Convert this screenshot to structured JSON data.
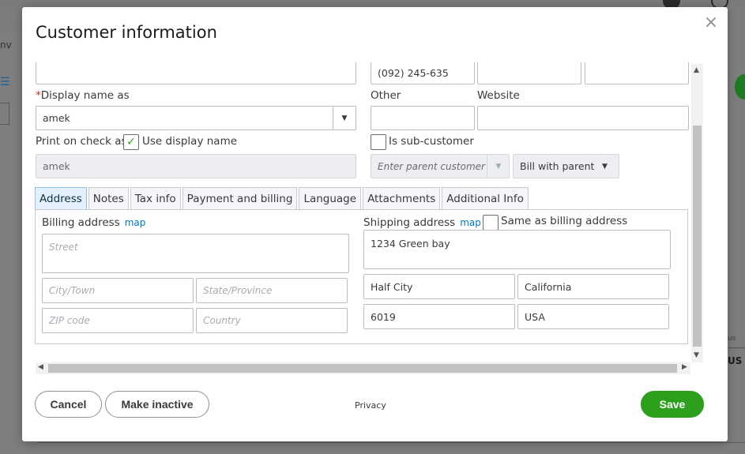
{
  "background": {
    "left_text": "nv",
    "right_label": "US",
    "right_small": "us"
  },
  "modal": {
    "title": "Customer information",
    "close_glyph": "×"
  },
  "form": {
    "top_field_value": "",
    "phone_value": "(092) 245-635",
    "phone_field2_value": "",
    "phone_field3_value": "",
    "display_name_label": "Display name as",
    "display_name_required": "*",
    "display_name_value": "amek",
    "other_label": "Other",
    "other_value": "",
    "website_label": "Website",
    "website_value": "",
    "print_on_check_label": "Print on check as",
    "use_display_name_label": "Use display name",
    "use_display_name_checked": true,
    "print_on_check_value": "amek",
    "is_sub_customer_label": "Is sub-customer",
    "is_sub_customer_checked": false,
    "parent_customer_placeholder": "Enter parent customer",
    "bill_with_parent_value": "Bill with parent"
  },
  "tabs": [
    {
      "label": "Address",
      "active": true
    },
    {
      "label": "Notes",
      "active": false
    },
    {
      "label": "Tax info",
      "active": false
    },
    {
      "label": "Payment and billing",
      "active": false
    },
    {
      "label": "Language",
      "active": false
    },
    {
      "label": "Attachments",
      "active": false
    },
    {
      "label": "Additional Info",
      "active": false
    }
  ],
  "billing": {
    "label": "Billing address",
    "map_link": "map",
    "street_placeholder": "Street",
    "city_placeholder": "City/Town",
    "state_placeholder": "State/Province",
    "zip_placeholder": "ZIP code",
    "country_placeholder": "Country"
  },
  "shipping": {
    "label": "Shipping address",
    "map_link": "map",
    "same_as_billing_label": "Same as billing address",
    "same_as_billing_checked": false,
    "street_value": "1234 Green bay",
    "city_value": "Half City",
    "state_value": "California",
    "zip_value": "6019",
    "country_value": "USA"
  },
  "footer": {
    "cancel_label": "Cancel",
    "make_inactive_label": "Make inactive",
    "privacy_label": "Privacy",
    "save_label": "Save"
  },
  "colors": {
    "accent_green": "#2ca01c",
    "link_blue": "#0077c5",
    "required_red": "#d52b1e"
  }
}
